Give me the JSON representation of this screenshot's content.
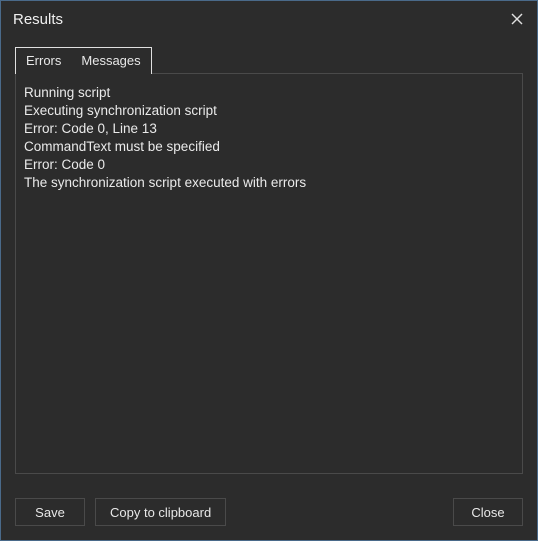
{
  "window": {
    "title": "Results"
  },
  "tabs": {
    "errors": "Errors",
    "messages": "Messages"
  },
  "log": {
    "lines": [
      "Running script",
      "Executing synchronization script",
      "Error: Code 0, Line 13",
      "CommandText must be specified",
      "Error: Code 0",
      "The synchronization script executed with errors"
    ]
  },
  "footer": {
    "save": "Save",
    "copy": "Copy to clipboard",
    "close": "Close"
  }
}
